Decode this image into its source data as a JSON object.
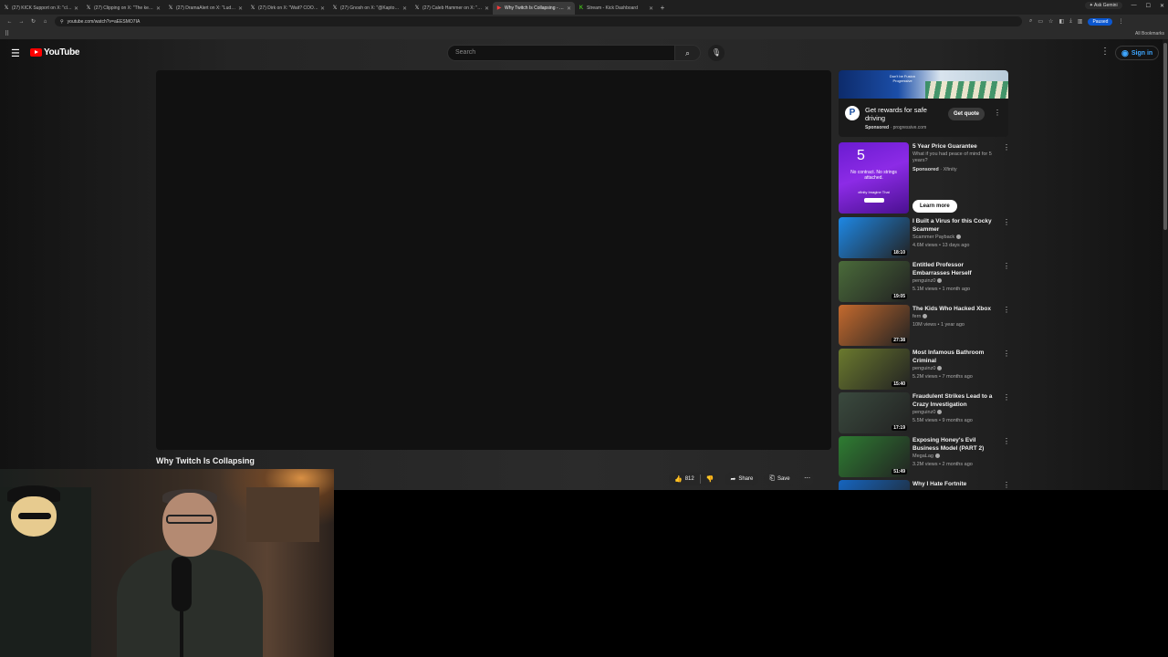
{
  "browser": {
    "tabs": [
      {
        "label": "(27) KICK Support on X: \"claims",
        "favicon": "x-icon",
        "active": false
      },
      {
        "label": "(27) Clipping on X: \"The kep 3/",
        "favicon": "x-icon",
        "active": false
      },
      {
        "label": "(27) DramaAlert on X: \"Ludwig",
        "favicon": "x-icon",
        "active": false
      },
      {
        "label": "(27) Dirk on X: \"Wait? COOKE",
        "favicon": "x-icon",
        "active": false
      },
      {
        "label": "(27) Gnosh on X: \"@Kaptor_ Co",
        "favicon": "x-icon",
        "active": false
      },
      {
        "label": "(27) Caleb Hammer on X: \"Twit",
        "favicon": "x-icon",
        "active": false
      },
      {
        "label": "Why Twitch Is Collapsing - You",
        "favicon": "youtube-icon",
        "active": true
      },
      {
        "label": "Stream - Kick Dashboard",
        "favicon": "kick-icon",
        "active": false
      }
    ],
    "ask_gemini": "Ask Gemini",
    "url": "youtube.com/watch?v=aEESMO7IA",
    "paused_label": "Paused",
    "all_bookmarks": "All Bookmarks"
  },
  "youtube": {
    "logo_text": "YouTube",
    "search_placeholder": "Search",
    "sign_in": "Sign in",
    "video_title": "Why Twitch Is Collapsing",
    "like_count": "812",
    "share_label": "Share",
    "save_label": "Save"
  },
  "ad": {
    "banner_text": "Don't be Fusion Progressive",
    "title": "Get rewards for safe driving",
    "sponsored": "Sponsored",
    "domain": "progressive.com",
    "cta": "Get quote"
  },
  "sponsored_card": {
    "thumb_big": "5",
    "thumb_text": "No contract. No strings attached.",
    "thumb_brand": "xfinity  Imagine That",
    "title": "5 Year Price Guarantee",
    "desc": "What if you had peace of mind for 5 years?",
    "sponsored": "Sponsored",
    "advertiser": "Xfinity",
    "cta": "Learn more"
  },
  "recommendations": [
    {
      "title": "I Built a Virus for this Cocky Scammer",
      "channel": "Scammer Payback",
      "meta": "4.6M views • 13 days ago",
      "duration": "18:10",
      "thumb": "#1e88e5"
    },
    {
      "title": "Entitled Professor Embarrasses Herself",
      "channel": "penguinz0",
      "meta": "5.1M views • 1 month ago",
      "duration": "19:05",
      "thumb": "#4a6b3a"
    },
    {
      "title": "The Kids Who Hacked Xbox",
      "channel": "fern",
      "meta": "10M views • 1 year ago",
      "duration": "27:38",
      "thumb": "#c46a2e"
    },
    {
      "title": "Most Infamous Bathroom Criminal",
      "channel": "penguinz0",
      "meta": "5.2M views • 7 months ago",
      "duration": "15:40",
      "thumb": "#6b7a2e"
    },
    {
      "title": "Fraudulent Strikes Lead to a Crazy Investigation",
      "channel": "penguinz0",
      "meta": "5.5M views • 9 months ago",
      "duration": "17:19",
      "thumb": "#3a4a3e"
    },
    {
      "title": "Exposing Honey's Evil Business Model (PART 2)",
      "channel": "MegaLag",
      "meta": "3.2M views • 2 months ago",
      "duration": "51:49",
      "thumb": "#2e7d32"
    },
    {
      "title": "Why I Hate Fortnite",
      "channel": "",
      "meta": "",
      "duration": "",
      "thumb": "#1565c0"
    }
  ]
}
